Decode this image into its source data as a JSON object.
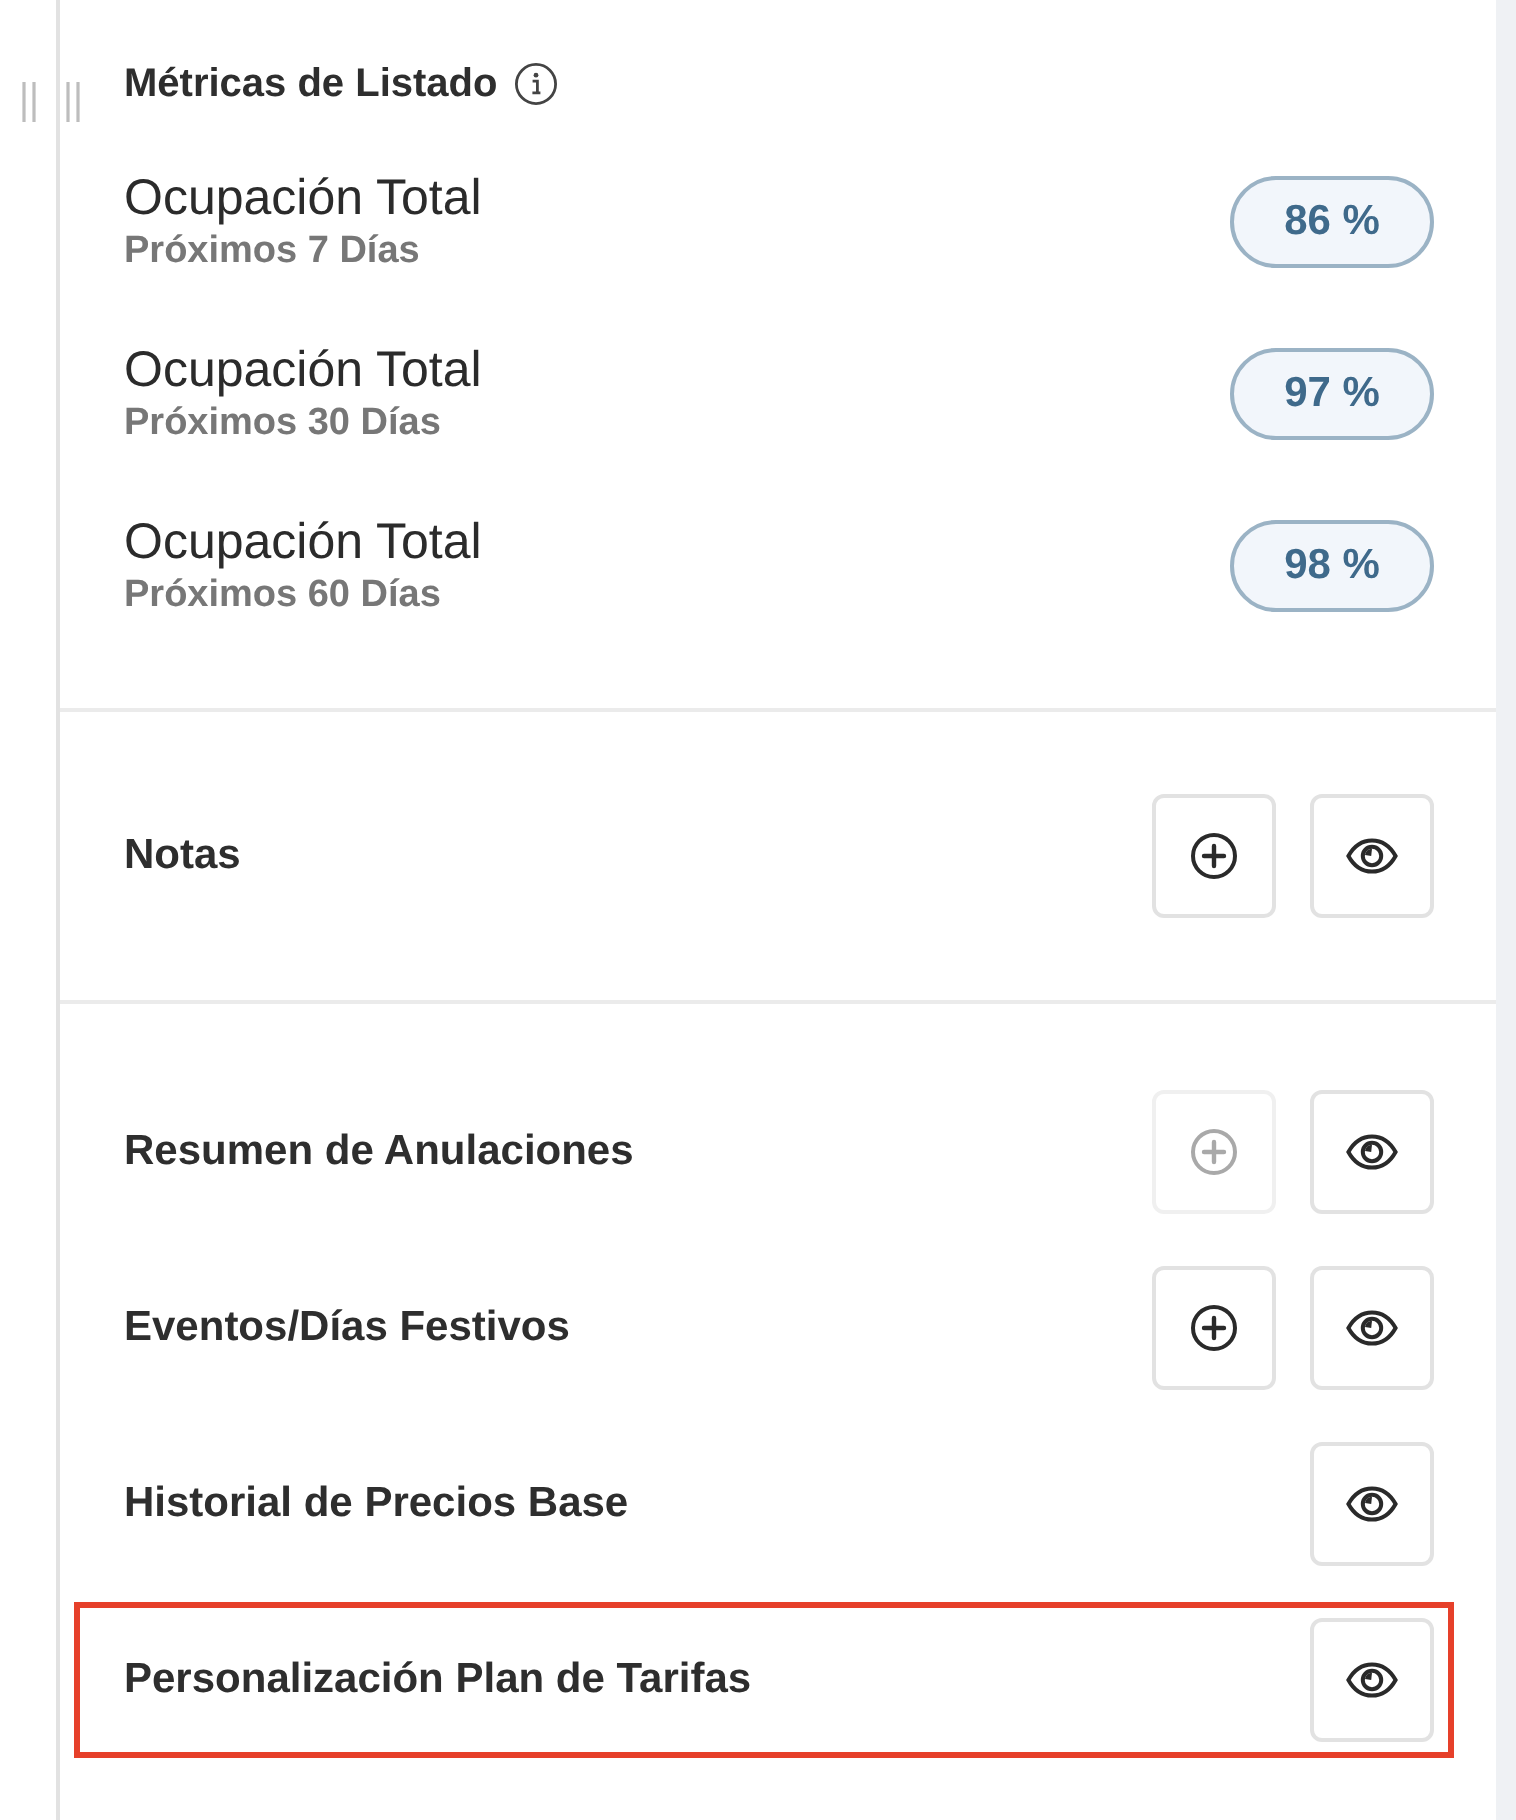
{
  "metrics": {
    "title": "Métricas de Listado",
    "items": [
      {
        "label": "Ocupación Total",
        "sublabel": "Próximos 7 Días",
        "value": "86 %"
      },
      {
        "label": "Ocupación Total",
        "sublabel": "Próximos 30 Días",
        "value": "97 %"
      },
      {
        "label": "Ocupación Total",
        "sublabel": "Próximos 60 Días",
        "value": "98 %"
      }
    ]
  },
  "sections": [
    {
      "items": [
        {
          "label": "Notas",
          "highlighted": false,
          "actions": [
            {
              "kind": "add",
              "disabled": false
            },
            {
              "kind": "view",
              "disabled": false
            }
          ]
        }
      ]
    },
    {
      "items": [
        {
          "label": "Resumen de Anulaciones",
          "highlighted": false,
          "actions": [
            {
              "kind": "add",
              "disabled": true
            },
            {
              "kind": "view",
              "disabled": false
            }
          ]
        },
        {
          "label": "Eventos/Días Festivos",
          "highlighted": false,
          "actions": [
            {
              "kind": "add",
              "disabled": false
            },
            {
              "kind": "view",
              "disabled": false
            }
          ]
        },
        {
          "label": "Historial de Precios Base",
          "highlighted": false,
          "actions": [
            {
              "kind": "view",
              "disabled": false
            }
          ]
        },
        {
          "label": "Personalización Plan de Tarifas",
          "highlighted": true,
          "actions": [
            {
              "kind": "view",
              "disabled": false
            }
          ]
        }
      ]
    }
  ]
}
